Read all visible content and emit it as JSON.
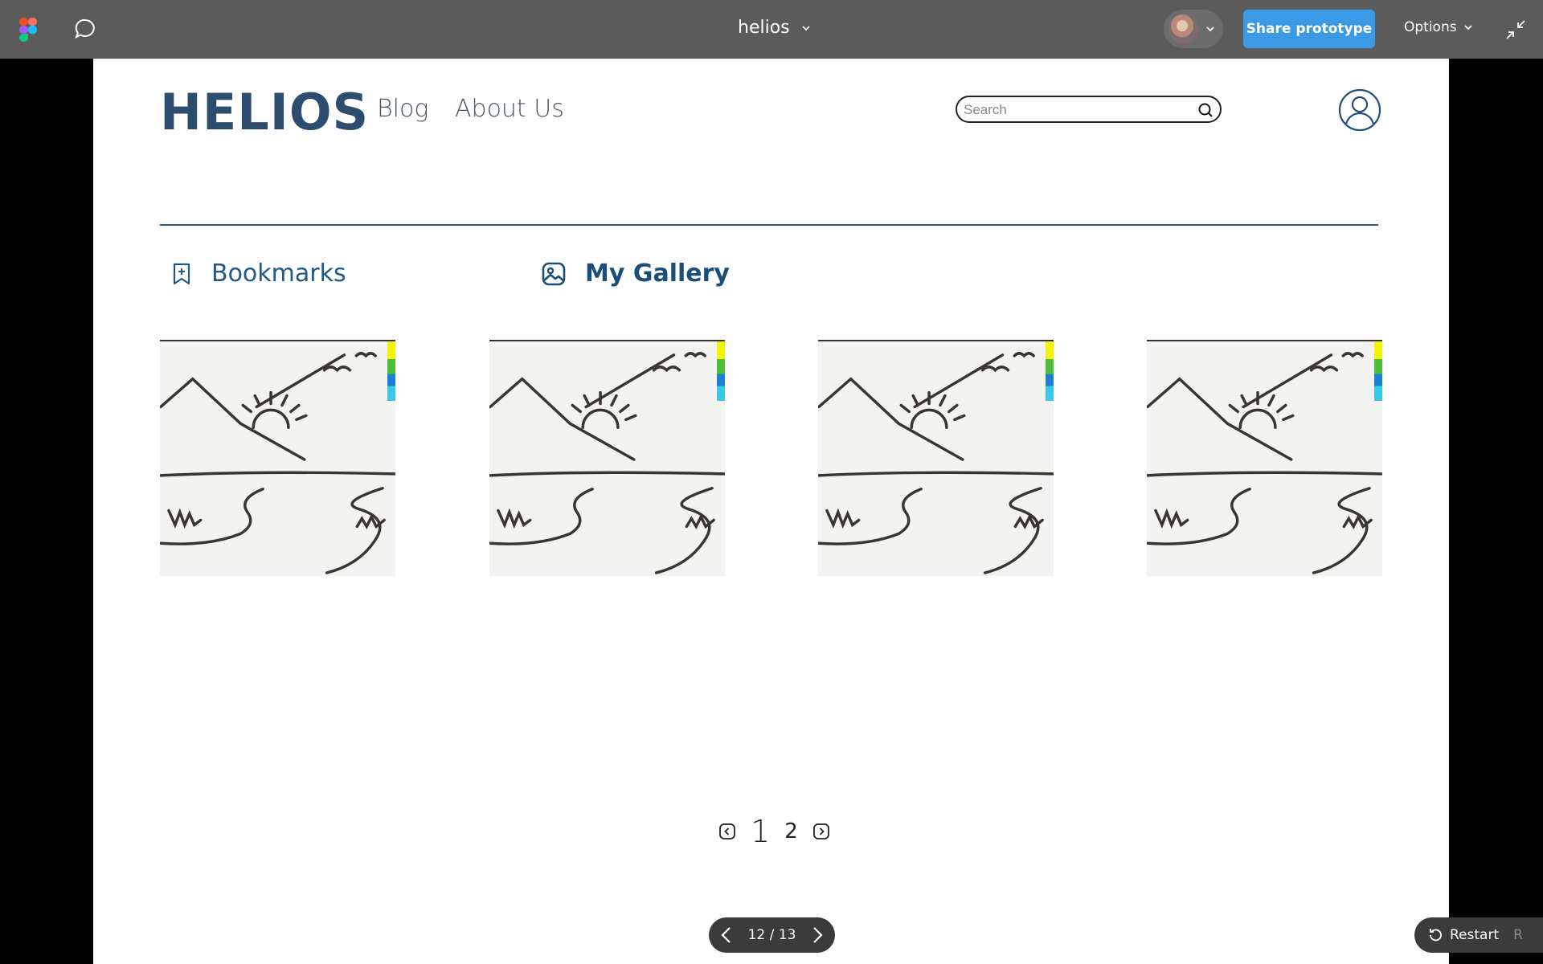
{
  "viewer": {
    "file_title": "helios",
    "share_label": "Share prototype",
    "options_label": "Options",
    "slide_counter": "12 / 13",
    "restart_label": "Restart",
    "restart_key": "R",
    "share_color": "#3b9ae6"
  },
  "site": {
    "logo": "HELIOS",
    "nav": [
      "Blog",
      "About Us"
    ],
    "search_placeholder": "Search",
    "brand_color": "#2d4d6e"
  },
  "tabs": [
    {
      "label": "Bookmarks",
      "icon": "bookmark-plus-icon",
      "active": false
    },
    {
      "label": "My Gallery",
      "icon": "image-icon",
      "active": true
    }
  ],
  "gallery": {
    "items": [
      {
        "image": "sunset-mountain-drawing"
      },
      {
        "image": "sunset-mountain-drawing"
      },
      {
        "image": "sunset-mountain-drawing"
      },
      {
        "image": "sunset-mountain-drawing"
      }
    ]
  },
  "pagination": {
    "pages": [
      "1",
      "2"
    ],
    "current": "1"
  }
}
